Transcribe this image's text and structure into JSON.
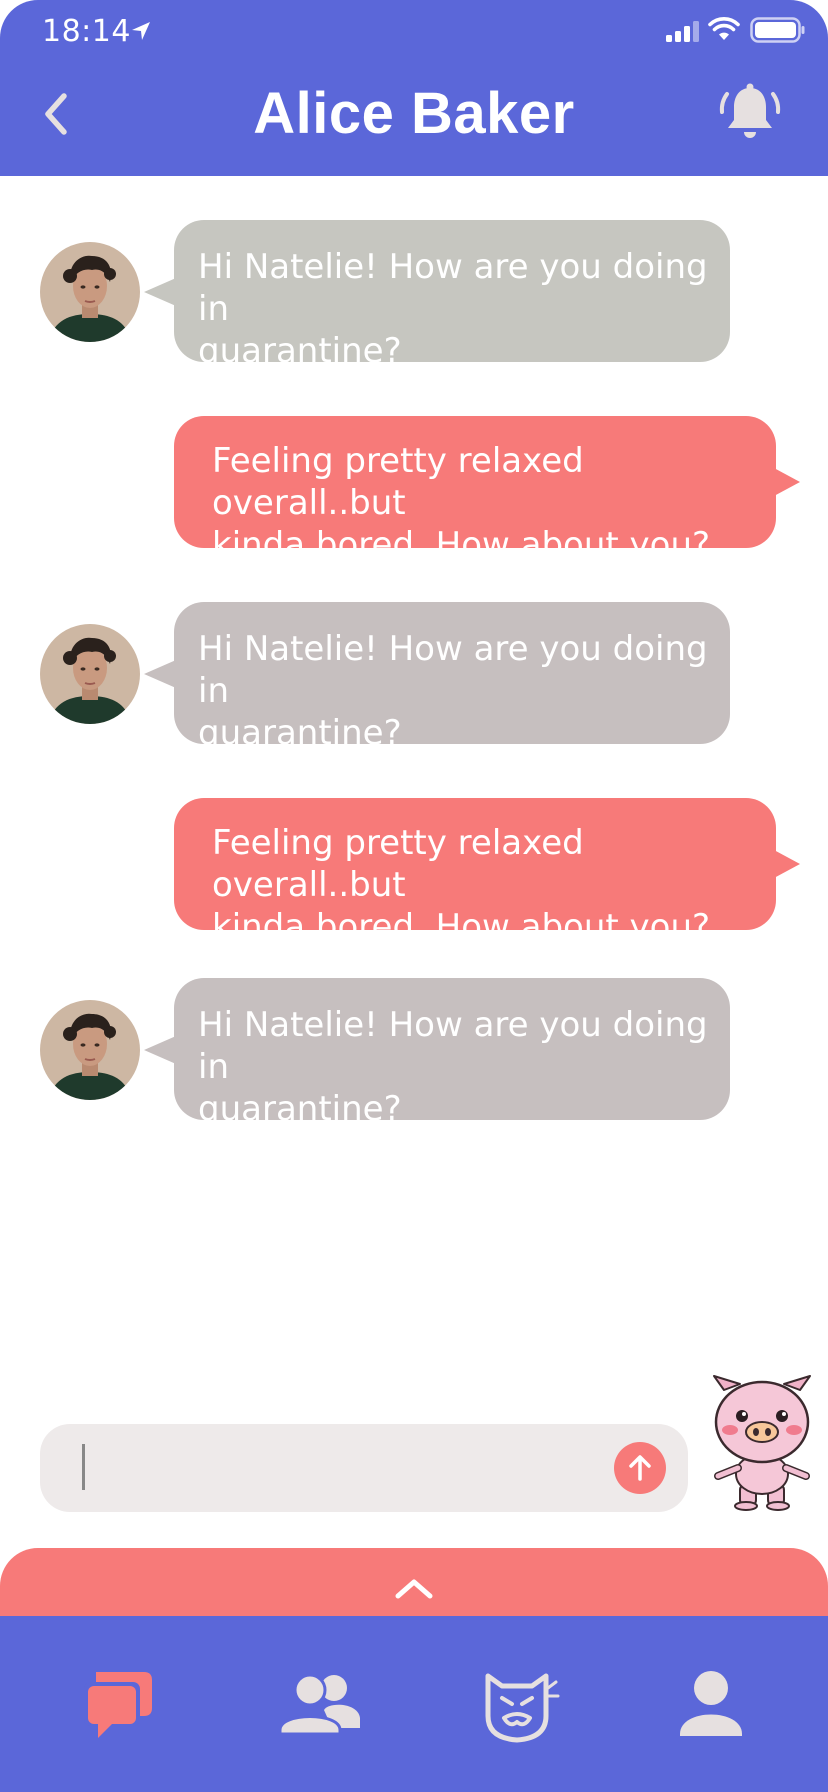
{
  "status_bar": {
    "time": "18:14"
  },
  "header": {
    "title": "Alice Baker",
    "icons": [
      "back-chevron-icon",
      "bell-icon"
    ]
  },
  "colors": {
    "header_bg": "#5b67d9",
    "outgoing_bubble": "#f77a79",
    "incoming_bubble_1": "#c6c6c0",
    "incoming_bubble_2": "#c6bfbf",
    "input_bg": "#eeeaea",
    "tab_active": "#f77a79",
    "tab_inactive": "#e6e0e0"
  },
  "messages": [
    {
      "direction": "incoming",
      "lines": [
        "Hi Natelie! How are you doing in",
        "quarantine?"
      ]
    },
    {
      "direction": "outgoing",
      "lines": [
        "Feeling pretty relaxed overall..but",
        "kinda bored. How about you?"
      ]
    },
    {
      "direction": "incoming",
      "lines": [
        "Hi Natelie! How are you doing in",
        "quarantine?"
      ]
    },
    {
      "direction": "outgoing",
      "lines": [
        "Feeling pretty relaxed overall..but",
        "kinda bored. How about you?"
      ]
    },
    {
      "direction": "incoming",
      "lines": [
        "Hi Natelie! How are you doing in",
        "quarantine?"
      ]
    }
  ],
  "composer": {
    "value": "",
    "send_icon": "arrow-up-icon",
    "sticker": "pig-sticker"
  },
  "tabs": [
    {
      "icon": "chat-bubbles-icon",
      "active": true
    },
    {
      "icon": "friends-icon",
      "active": false
    },
    {
      "icon": "cat-mask-icon",
      "active": false
    },
    {
      "icon": "profile-icon",
      "active": false
    }
  ]
}
